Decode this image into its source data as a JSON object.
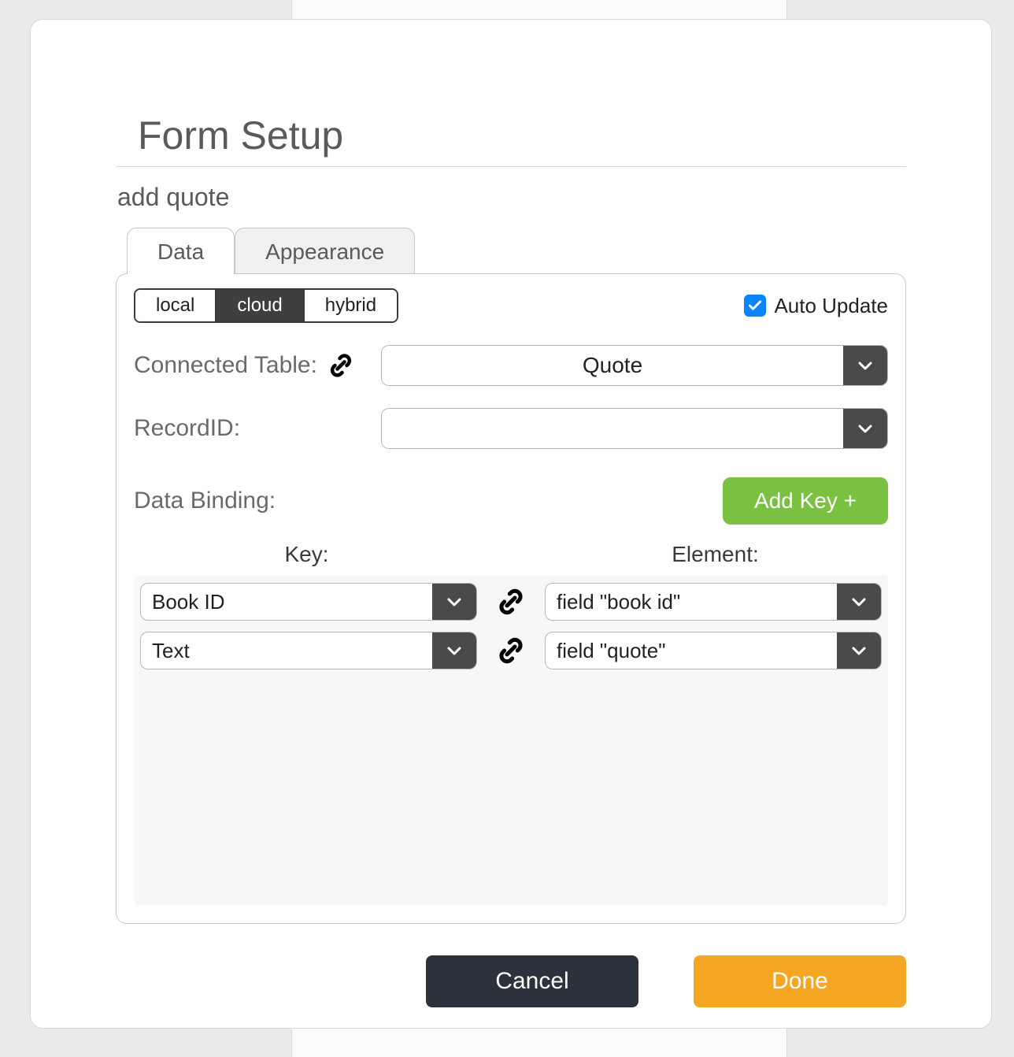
{
  "modal": {
    "title": "Form Setup",
    "subtitle": "add quote"
  },
  "tabs": {
    "data": "Data",
    "appearance": "Appearance",
    "active": "data"
  },
  "storage_modes": {
    "local": "local",
    "cloud": "cloud",
    "hybrid": "hybrid",
    "selected": "cloud"
  },
  "auto_update": {
    "label": "Auto Update",
    "checked": true
  },
  "connected_table": {
    "label": "Connected Table:",
    "value": "Quote"
  },
  "record_id": {
    "label": "RecordID:",
    "value": ""
  },
  "binding": {
    "label": "Data Binding:",
    "add_key_label": "Add Key +",
    "key_header": "Key:",
    "element_header": "Element:",
    "rows": [
      {
        "key": "Book ID",
        "element": "field \"book id\""
      },
      {
        "key": "Text",
        "element": "field \"quote\""
      }
    ]
  },
  "footer": {
    "cancel": "Cancel",
    "done": "Done"
  },
  "colors": {
    "accent_blue": "#0a84ff",
    "accent_green": "#7ac142",
    "accent_orange": "#f5a623",
    "dark": "#2c323c"
  }
}
